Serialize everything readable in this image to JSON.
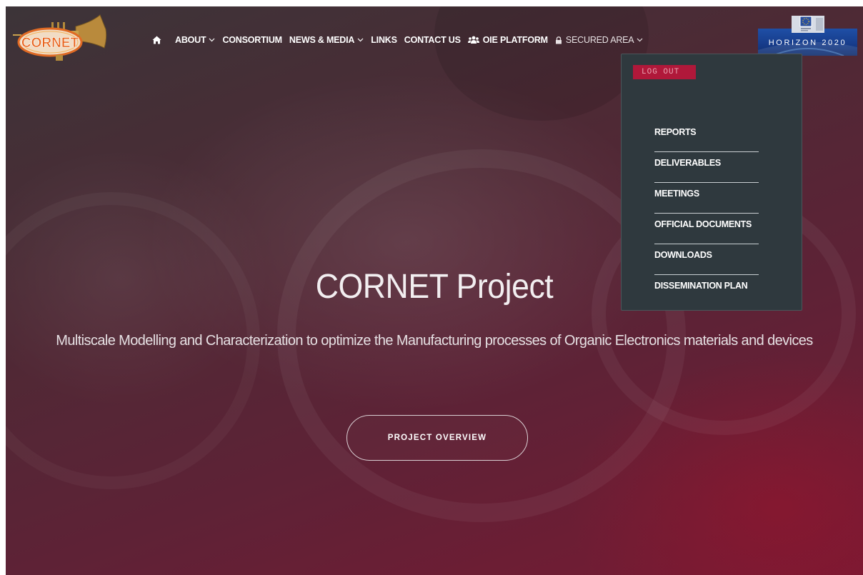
{
  "header": {
    "logo_text": "CORNET",
    "nav": {
      "home_icon": "home-icon",
      "about": "ABOUT",
      "consortium": "CONSORTIUM",
      "news_media": "NEWS & MEDIA",
      "links": "LINKS",
      "contact_us": "CONTACT US",
      "oie_platform": "OIE PLATFORM",
      "oie_icon": "users-icon",
      "secured_area": "SECURED AREA",
      "secured_icon": "lock-icon"
    },
    "horizon_text": "HORIZON 2020"
  },
  "dropdown": {
    "logout_label": "LOG OUT",
    "items": [
      "REPORTS",
      "DELIVERABLES",
      "MEETINGS",
      "OFFICIAL DOCUMENTS",
      "DOWNLOADS",
      "DISSEMINATION PLAN"
    ]
  },
  "hero": {
    "title": "CORNET Project",
    "subtitle": "Multiscale Modelling and Characterization to optimize the Manufacturing processes of Organic Electronics materials and devices",
    "button_label": "PROJECT OVERVIEW"
  },
  "colors": {
    "accent": "#b0183a",
    "dropdown_bg": "#2f393e",
    "hero_bg_dark": "#3c3438",
    "hero_bg_crimson": "#781a33"
  }
}
